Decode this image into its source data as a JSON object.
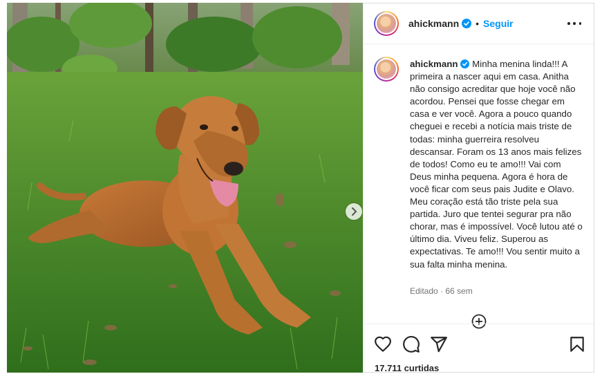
{
  "post": {
    "username": "ahickmann",
    "follow_label": "Seguir",
    "separator": "•",
    "caption": "Minha menina linda!!! A primeira a nascer aqui em casa. Anitha não consigo acreditar que hoje você não acordou. Pensei que fosse chegar em casa e ver você. Agora a pouco quando cheguei e recebi a notícia mais triste de todas: minha guerreira resolveu descansar. Foram os 13 anos mais felizes de todos! Como eu te amo!!! Vai com Deus minha pequena. Agora é hora de você ficar com seus pais Judite e Olavo. Meu coração está tão triste pela sua partida. Juro que tentei segurar pra não chorar, mas é impossível. Você lutou até o último dia. Viveu feliz. Superou as expectativas. Te amo!!! Vou sentir muito a sua falta minha menina.",
    "edited_label": "Editado · 66 sem",
    "likes_label": "17.711 curtidas"
  },
  "icons": {
    "verified": "verified-badge-icon",
    "more": "more-options-icon",
    "next": "chevron-right-icon",
    "add_comment": "plus-circle-icon",
    "like": "heart-icon",
    "comment": "comment-icon",
    "share": "share-icon",
    "save": "bookmark-icon"
  },
  "colors": {
    "link_blue": "#0095f6",
    "text": "#262626",
    "muted": "#737373",
    "border": "#dbdbdb"
  }
}
